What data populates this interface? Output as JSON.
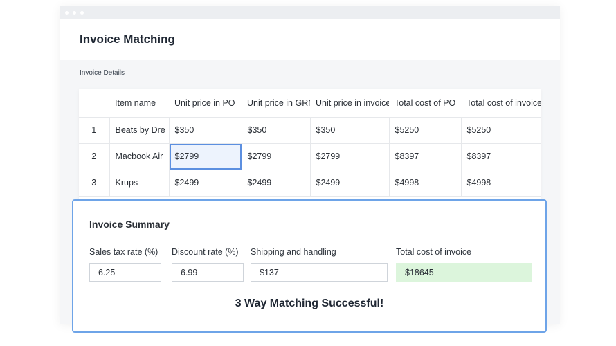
{
  "header": {
    "title": "Invoice Matching"
  },
  "section_label": "Invoice Details",
  "table": {
    "columns": [
      "",
      "Item name",
      "Unit price in PO",
      "Unit price in GRN",
      "Unit price in invoice",
      "Total cost of PO",
      "Total cost of invoice"
    ],
    "rows": [
      [
        "1",
        "Beats by Dre",
        "$350",
        "$350",
        "$350",
        "$5250",
        "$5250"
      ],
      [
        "2",
        "Macbook Air",
        "$2799",
        "$2799",
        "$2799",
        "$8397",
        "$8397"
      ],
      [
        "3",
        "Krups",
        "$2499",
        "$2499",
        "$2499",
        "$4998",
        "$4998"
      ]
    ]
  },
  "summary": {
    "title": "Invoice Summary",
    "fields": [
      {
        "label": "Sales tax rate (%)",
        "value": "6.25"
      },
      {
        "label": "Discount rate (%)",
        "value": "6.99"
      },
      {
        "label": "Shipping and handling",
        "value": "$137"
      },
      {
        "label": "Total cost of invoice",
        "value": "$18645"
      }
    ],
    "status": "3 Way Matching Successful!"
  },
  "colors": {
    "accent": "#6ea4e8",
    "selected_cell": "#edf3fd",
    "success_field": "#dcf5dc"
  }
}
